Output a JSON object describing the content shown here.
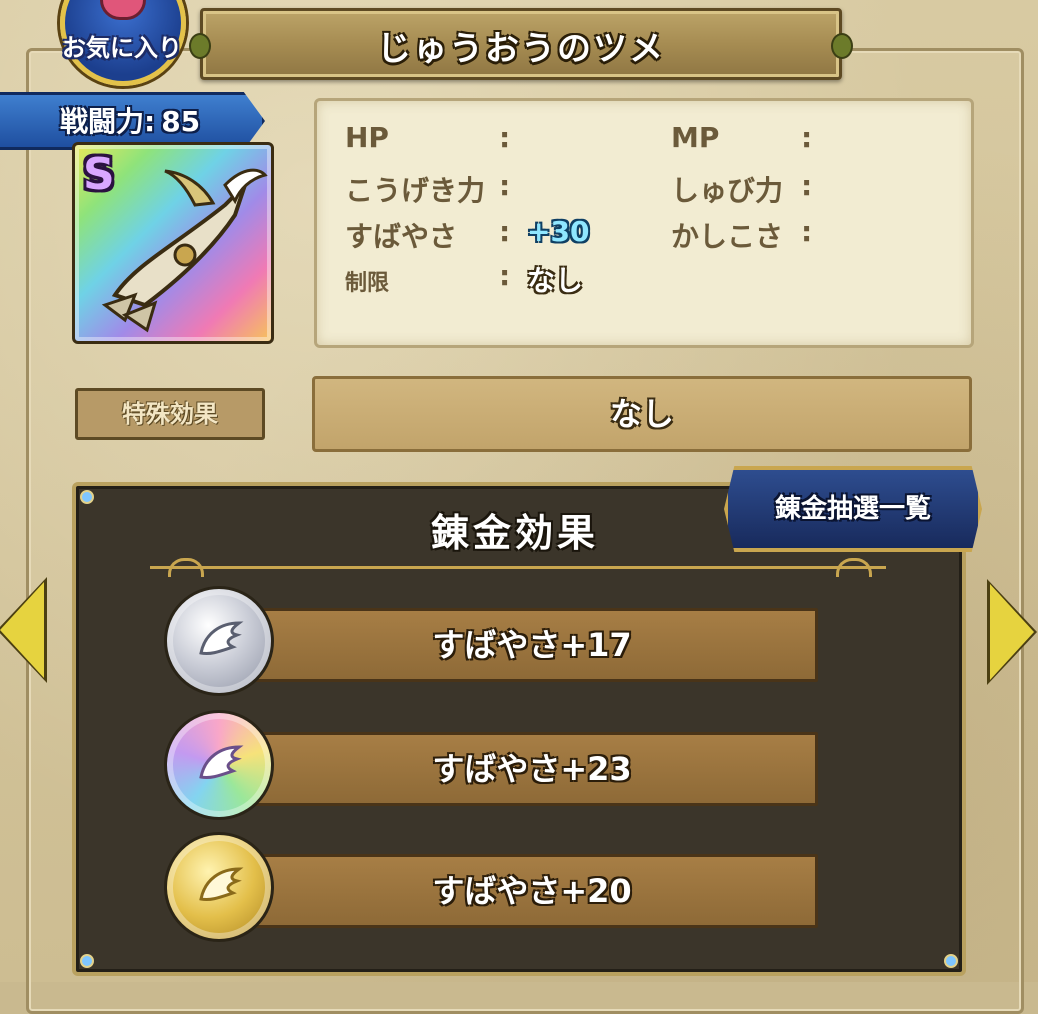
{
  "header": {
    "favorite_label": "お気に入り",
    "item_name": "じゅうおうのツメ"
  },
  "power": {
    "label": "戦闘力:",
    "value": "85"
  },
  "item": {
    "rank": "S",
    "icon": "claw-weapon-icon"
  },
  "stats": {
    "hp_label": "HP",
    "mp_label": "MP",
    "atk_label": "こうげき力",
    "def_label": "しゅび力",
    "spd_label": "すばやさ",
    "spd_value": "+30",
    "int_label": "かしこさ",
    "restrict_label": "制限",
    "restrict_value": "なし",
    "colon": ":"
  },
  "special": {
    "label": "特殊効果",
    "value": "なし"
  },
  "alchemy": {
    "title": "錬金効果",
    "lottery_button": "錬金抽選一覧",
    "effects": [
      {
        "medal": "silver",
        "stat": "すばやさ",
        "value": "+17"
      },
      {
        "medal": "rainbow",
        "stat": "すばやさ",
        "value": "+23"
      },
      {
        "medal": "gold",
        "stat": "すばやさ",
        "value": "+20"
      }
    ]
  },
  "colors": {
    "parchment": "#d8caa2",
    "dark_panel": "#3b352a",
    "speed_value": "#8fe7ff"
  }
}
